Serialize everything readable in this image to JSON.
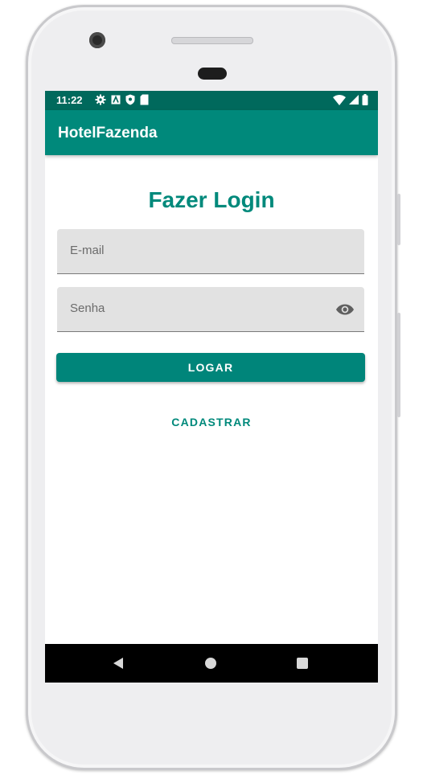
{
  "status_bar": {
    "time": "11:22",
    "left_icons": [
      "settings-icon",
      "font-icon",
      "shield-icon",
      "sd-card-icon"
    ],
    "right_icons": [
      "wifi-icon",
      "signal-icon",
      "battery-icon"
    ]
  },
  "app_bar": {
    "title": "HotelFazenda"
  },
  "login": {
    "heading": "Fazer Login",
    "email_placeholder": "E-mail",
    "password_placeholder": "Senha",
    "login_button": "LOGAR",
    "register_button": "CADASTRAR"
  },
  "nav_bar": {
    "buttons": [
      "back-icon",
      "home-icon",
      "recents-icon"
    ]
  },
  "colors": {
    "primary": "#00897b",
    "primary_dark": "#00695c",
    "field_background": "#e2e2e2"
  }
}
